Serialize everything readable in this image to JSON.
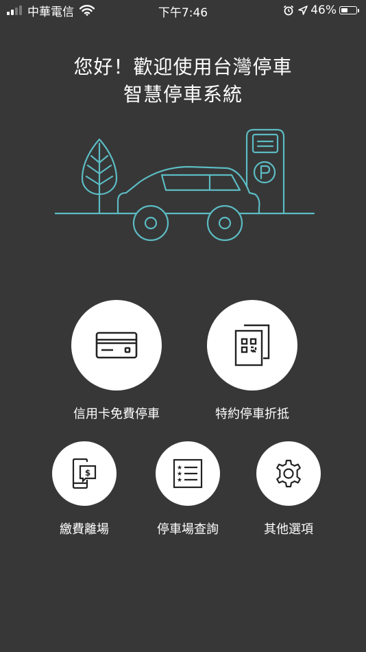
{
  "status_bar": {
    "carrier": "中華電信",
    "time": "下午7:46",
    "battery_percent": "46%",
    "battery_level": 0.46,
    "icons": [
      "signal-icon",
      "wifi-icon",
      "alarm-icon",
      "location-icon",
      "battery-icon"
    ]
  },
  "greeting": {
    "line1": "您好！歡迎使用台灣停車",
    "line2": "智慧停車系統"
  },
  "colors": {
    "background": "#373737",
    "illustration_stroke": "#5cbcc4",
    "button_bg": "#ffffff",
    "icon_stroke": "#222222",
    "text": "#ffffff"
  },
  "menu": {
    "credit_card": {
      "label": "信用卡免費停車",
      "icon": "credit-card-icon"
    },
    "contract": {
      "label": "特約停車折抵",
      "icon": "qr-document-icon"
    },
    "pay_exit": {
      "label": "繳費離場",
      "icon": "mobile-payment-icon"
    },
    "lot_search": {
      "label": "停車場查詢",
      "icon": "list-icon"
    },
    "other": {
      "label": "其他選項",
      "icon": "gear-icon"
    }
  }
}
